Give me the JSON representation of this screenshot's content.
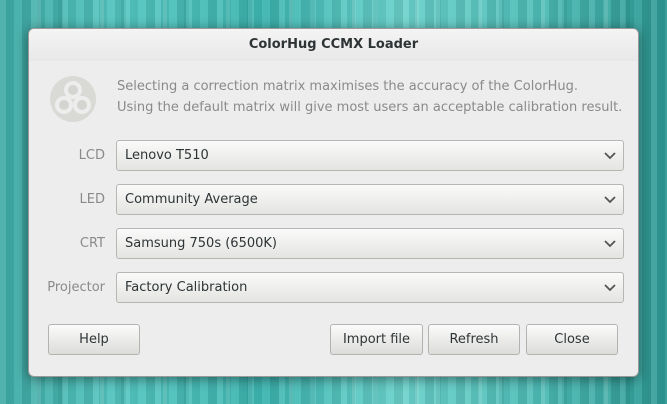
{
  "window": {
    "title": "ColorHug CCMX Loader"
  },
  "intro": {
    "icon": "colorhug-logo-icon",
    "line1": "Selecting a correction matrix maximises the accuracy of the ColorHug.",
    "line2": "Using the default matrix will give most users an acceptable calibration result."
  },
  "fields": [
    {
      "label": "LCD",
      "value": "Lenovo T510"
    },
    {
      "label": "LED",
      "value": "Community Average"
    },
    {
      "label": "CRT",
      "value": "Samsung 750s (6500K)"
    },
    {
      "label": "Projector",
      "value": "Factory Calibration"
    }
  ],
  "buttons": {
    "help": "Help",
    "import": "Import file",
    "refresh": "Refresh",
    "close": "Close"
  },
  "colors": {
    "wallpaper": "#4fbdb7",
    "dialog_bg": "#ededed",
    "muted_text": "#8a8a8a"
  }
}
